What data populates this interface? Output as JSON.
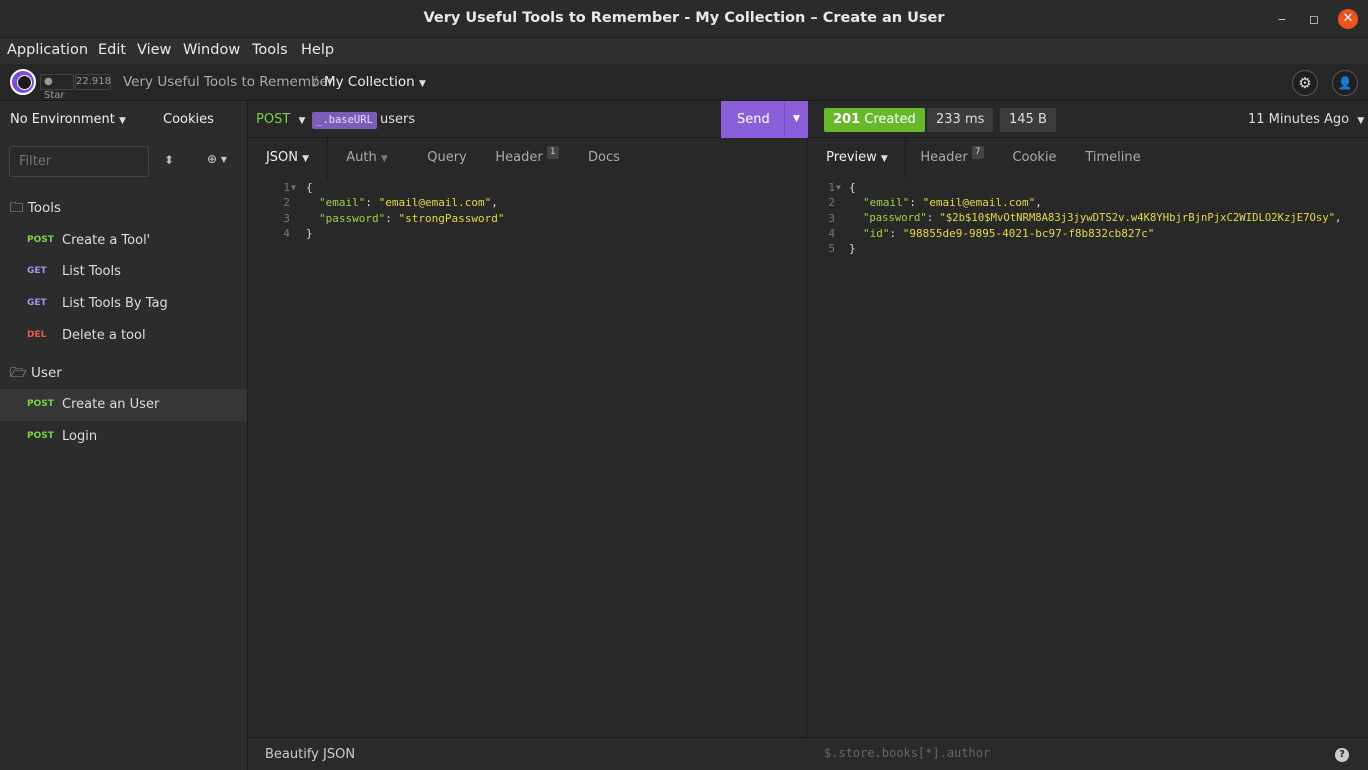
{
  "window": {
    "title": "Very Useful Tools to Remember - My Collection – Create an User",
    "minimize": "‒",
    "maximize": "◻",
    "close": "✕"
  },
  "menu": [
    "Application",
    "Edit",
    "View",
    "Window",
    "Tools",
    "Help"
  ],
  "topbar": {
    "github_star": "Star",
    "github_count": "22.918",
    "workspace": "Very Useful Tools to Remember",
    "separator": "/",
    "collection": "My Collection",
    "collection_caret": "▼",
    "settings_icon": "⚙",
    "account_icon": "👤"
  },
  "sidebar": {
    "environment": "No Environment",
    "environment_caret": "▼",
    "cookies": "Cookies",
    "filter_placeholder": "Filter",
    "sort_icon": "⬍",
    "add_icon": "⊕ ▾",
    "folders": [
      {
        "name": "Tools",
        "icon": "🗀",
        "requests": [
          {
            "method": "POST",
            "name": "Create a Tool'"
          },
          {
            "method": "GET",
            "name": "List Tools"
          },
          {
            "method": "GET",
            "name": "List Tools By Tag"
          },
          {
            "method": "DEL",
            "name": "Delete a tool"
          }
        ]
      },
      {
        "name": "User",
        "icon": "🗁",
        "requests": [
          {
            "method": "POST",
            "name": "Create an User",
            "active": true
          },
          {
            "method": "POST",
            "name": "Login"
          }
        ]
      }
    ]
  },
  "request": {
    "method": "POST",
    "method_caret": "▼",
    "url_tag": "_.baseURL",
    "url_rest": "users",
    "send": "Send",
    "send_caret": "▼",
    "tabs": {
      "json": "JSON",
      "json_caret": "▼",
      "auth": "Auth",
      "auth_caret": "▼",
      "query": "Query",
      "header": "Header",
      "header_count": "1",
      "docs": "Docs"
    },
    "body": {
      "l1": "{",
      "l2_key": "\"email\"",
      "l2_sep": ": ",
      "l2_val": "\"email@email.com\"",
      "l2_end": ",",
      "l3_key": "\"password\"",
      "l3_sep": ": ",
      "l3_val": "\"strongPassword\"",
      "l4": "}"
    },
    "footer": "Beautify JSON"
  },
  "response": {
    "status_code": "201",
    "status_text": "Created",
    "time": "233 ms",
    "size": "145 B",
    "ago": "11 Minutes Ago",
    "ago_caret": "▼",
    "tabs": {
      "preview": "Preview",
      "preview_caret": "▼",
      "header": "Header",
      "header_count": "7",
      "cookie": "Cookie",
      "timeline": "Timeline"
    },
    "body": {
      "l1": "{",
      "l2_key": "\"email\"",
      "l2_sep": ": ",
      "l2_val": "\"email@email.com\"",
      "l2_end": ",",
      "l3_key": "\"password\"",
      "l3_sep": ": ",
      "l3_val": "\"$2b$10$MvOtNRM8A83j3jywDTS2v.w4K8YHbjrBjnPjxC2WIDLO2KzjE7Osy\"",
      "l3_end": ",",
      "l4_key": "\"id\"",
      "l4_sep": ": ",
      "l4_val": "\"98855de9-9895-4021-bc97-f8b832cb827c\"",
      "l5": "}"
    },
    "filter_placeholder": "$.store.books[*].author",
    "help_icon": "?"
  },
  "colors": {
    "post": "#7cd14a",
    "get": "#a98ee6",
    "del": "#e85a4f",
    "accent": "#8a5fd9",
    "status_ok": "#67b82a"
  }
}
